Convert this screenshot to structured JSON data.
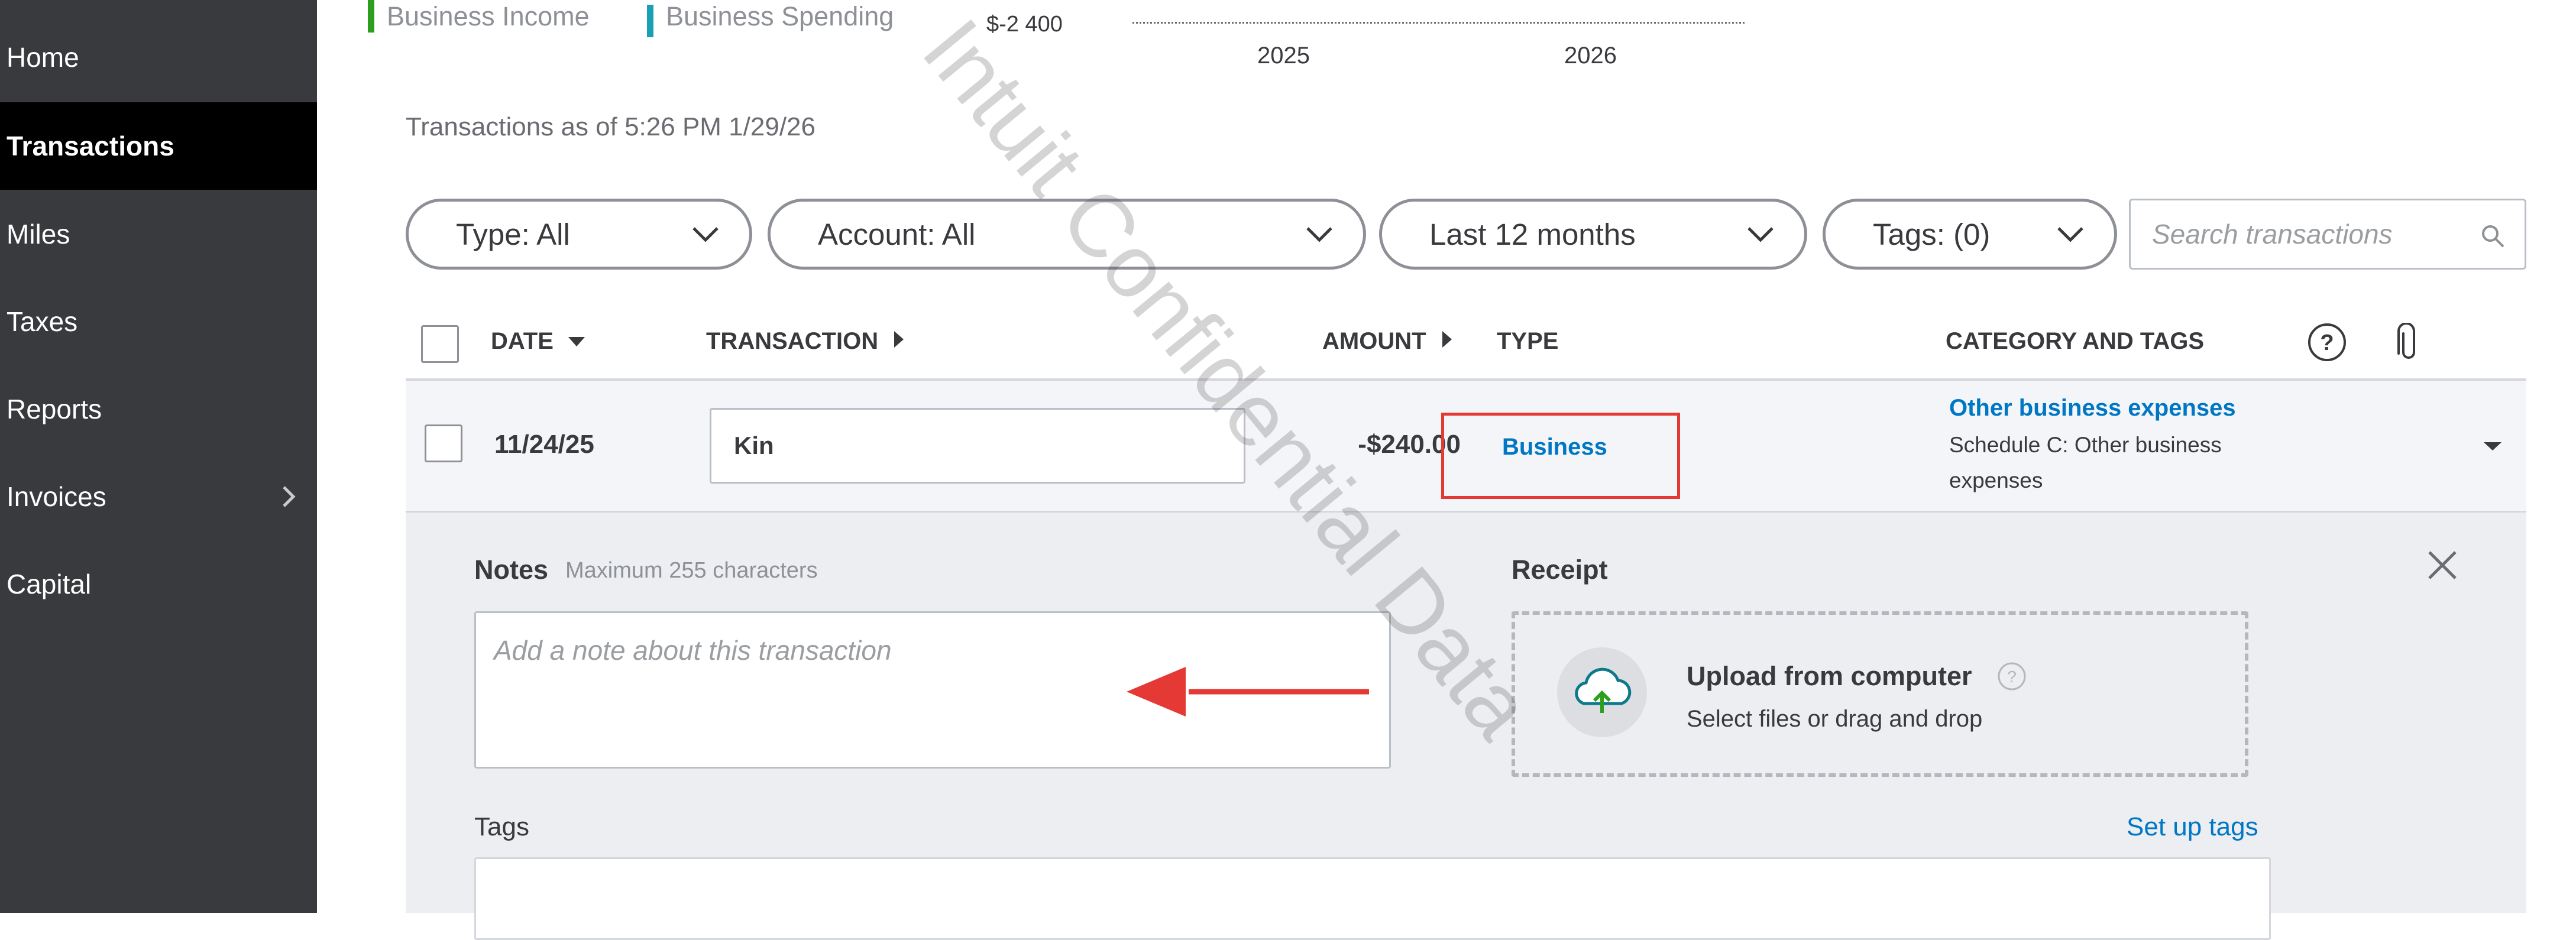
{
  "sidebar": {
    "items": [
      {
        "label": "Home"
      },
      {
        "label": "Transactions",
        "active": true
      },
      {
        "label": "Miles"
      },
      {
        "label": "Taxes"
      },
      {
        "label": "Reports"
      },
      {
        "label": "Invoices",
        "has_submenu": true
      },
      {
        "label": "Capital"
      }
    ]
  },
  "chart": {
    "legend": [
      {
        "label": "Business Income",
        "color": "#2ca01c"
      },
      {
        "label": "Business Spending",
        "color": "#1aa0b4"
      }
    ],
    "y_tick": "$-2 400",
    "x_ticks": [
      "2025",
      "2026"
    ]
  },
  "as_of": "Transactions as of 5:26 PM 1/29/26",
  "filters": {
    "type": "Type: All",
    "account": "Account: All",
    "period": "Last 12 months",
    "tags": "Tags: (0)",
    "search_placeholder": "Search transactions"
  },
  "table": {
    "headers": {
      "date": "DATE",
      "transaction": "TRANSACTION",
      "amount": "AMOUNT",
      "type": "TYPE",
      "category": "CATEGORY AND TAGS"
    },
    "rows": [
      {
        "date": "11/24/25",
        "transaction": "Kin",
        "amount": "-$240.00",
        "type": "Business",
        "category": "Other business expenses",
        "category_sub_1": "Schedule C: Other business",
        "category_sub_2": "expenses"
      }
    ]
  },
  "details": {
    "notes_label": "Notes",
    "notes_hint": "Maximum 255 characters",
    "notes_placeholder": "Add a note about this transaction",
    "receipt_label": "Receipt",
    "upload_title": "Upload from computer",
    "upload_sub": "Select files or drag and drop",
    "tags_label": "Tags",
    "setup_tags": "Set up tags"
  },
  "watermark": "Intuit Confidential Data",
  "colors": {
    "sidebar_bg": "#393a3d",
    "link_blue": "#0077c5",
    "annotation_red": "#e53935",
    "upload_green": "#2ca01c"
  },
  "icons": [
    "chevron-right-icon",
    "chevron-down-icon",
    "search-icon",
    "sort-down-icon",
    "sort-right-icon",
    "help-icon",
    "paperclip-icon",
    "dropdown-caret-icon",
    "close-icon",
    "cloud-upload-icon"
  ]
}
